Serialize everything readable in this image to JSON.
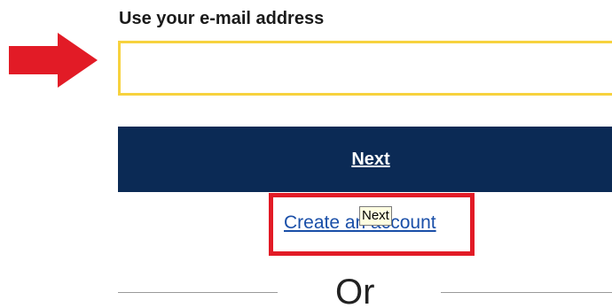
{
  "form": {
    "email_label": "Use your e-mail address",
    "email_value": "",
    "email_placeholder": "",
    "next_label": "Next",
    "create_account_label": "Create an account",
    "or_label": "Or"
  },
  "tooltip": {
    "text": "Next"
  },
  "annotations": {
    "arrow_icon": "red-arrow-icon",
    "arrow_color": "#e21b26",
    "highlight_color": "#e21b26"
  },
  "colors": {
    "input_border": "#f7d23e",
    "button_bg": "#0b2a55",
    "link": "#1a4fa8"
  }
}
